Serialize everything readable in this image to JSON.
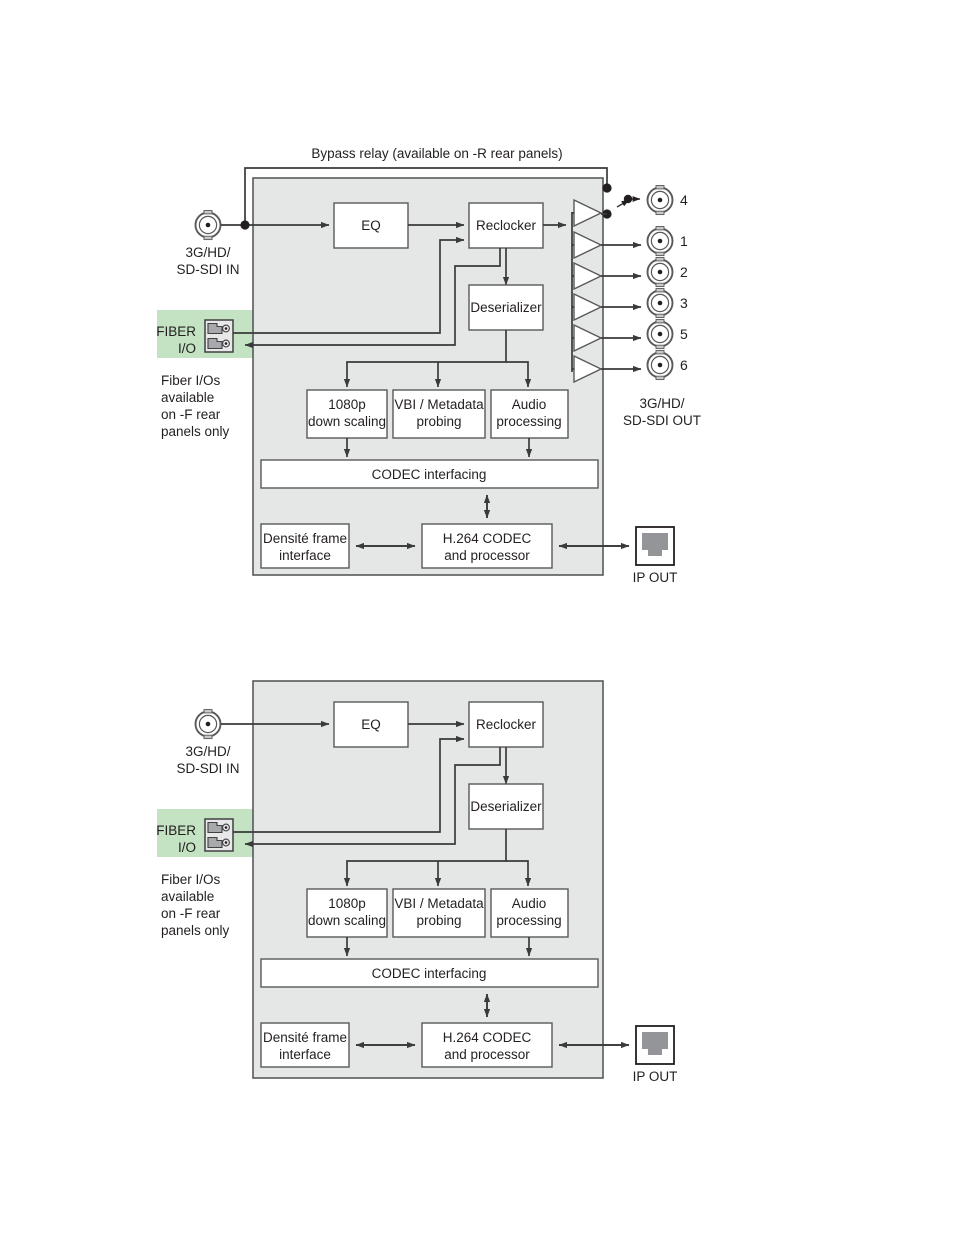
{
  "page": {
    "background": "#ffffff",
    "panel_fill": "#e5e6e6",
    "panel_stroke": "#58595b",
    "box_fill": "#ffffff",
    "fiber_highlight": "#c3e3c3",
    "wire_color": "#3a3a3c"
  },
  "diagrams": [
    {
      "id": "diagram-with-bypass",
      "title": "Bypass relay (available on -R rear panels)",
      "has_bypass_relay": true,
      "has_sdi_outputs": true,
      "input": {
        "connector": "bnc-connector",
        "label_line1": "3G/HD/",
        "label_line2": "SD-SDI IN"
      },
      "fiber": {
        "label_line1": "FIBER",
        "label_line2": "I/O",
        "connector": "sfp-fiber-connector",
        "note": [
          "Fiber I/Os",
          "available",
          "on -F rear",
          "panels only"
        ]
      },
      "blocks": [
        {
          "id": "eq",
          "label": "EQ"
        },
        {
          "id": "reclocker",
          "label": "Reclocker"
        },
        {
          "id": "deserializer",
          "label": "Deserializer"
        },
        {
          "id": "downscaling",
          "label_line1": "1080p",
          "label_line2": "down scaling"
        },
        {
          "id": "vbi-metadata",
          "label_line1": "VBI / Metadata",
          "label_line2": "probing"
        },
        {
          "id": "audio-processing",
          "label_line1": "Audio",
          "label_line2": "processing"
        },
        {
          "id": "codec-interfacing",
          "label": "CODEC interfacing"
        },
        {
          "id": "densite-frame",
          "label_line1": "Densité frame",
          "label_line2": "interface"
        },
        {
          "id": "h264-codec",
          "label_line1": "H.264 CODEC",
          "label_line2": "and processor"
        }
      ],
      "outputs": {
        "label_line1": "3G/HD/",
        "label_line2": "SD-SDI OUT",
        "ports": [
          "4",
          "1",
          "2",
          "3",
          "5",
          "6"
        ],
        "amplifier_count": 6
      },
      "ip_output": {
        "connector": "rj45-connector",
        "label": "IP OUT"
      }
    },
    {
      "id": "diagram-no-bypass",
      "title": "",
      "has_bypass_relay": false,
      "has_sdi_outputs": false,
      "input": {
        "connector": "bnc-connector",
        "label_line1": "3G/HD/",
        "label_line2": "SD-SDI IN"
      },
      "fiber": {
        "label_line1": "FIBER",
        "label_line2": "I/O",
        "connector": "sfp-fiber-connector",
        "note": [
          "Fiber I/Os",
          "available",
          "on -F rear",
          "panels only"
        ]
      },
      "blocks": [
        {
          "id": "eq",
          "label": "EQ"
        },
        {
          "id": "reclocker",
          "label": "Reclocker"
        },
        {
          "id": "deserializer",
          "label": "Deserializer"
        },
        {
          "id": "downscaling",
          "label_line1": "1080p",
          "label_line2": "down scaling"
        },
        {
          "id": "vbi-metadata",
          "label_line1": "VBI / Metadata",
          "label_line2": "probing"
        },
        {
          "id": "audio-processing",
          "label_line1": "Audio",
          "label_line2": "processing"
        },
        {
          "id": "codec-interfacing",
          "label": "CODEC interfacing"
        },
        {
          "id": "densite-frame",
          "label_line1": "Densité frame",
          "label_line2": "interface"
        },
        {
          "id": "h264-codec",
          "label_line1": "H.264 CODEC",
          "label_line2": "and processor"
        }
      ],
      "ip_output": {
        "connector": "rj45-connector",
        "label": "IP OUT"
      }
    }
  ]
}
